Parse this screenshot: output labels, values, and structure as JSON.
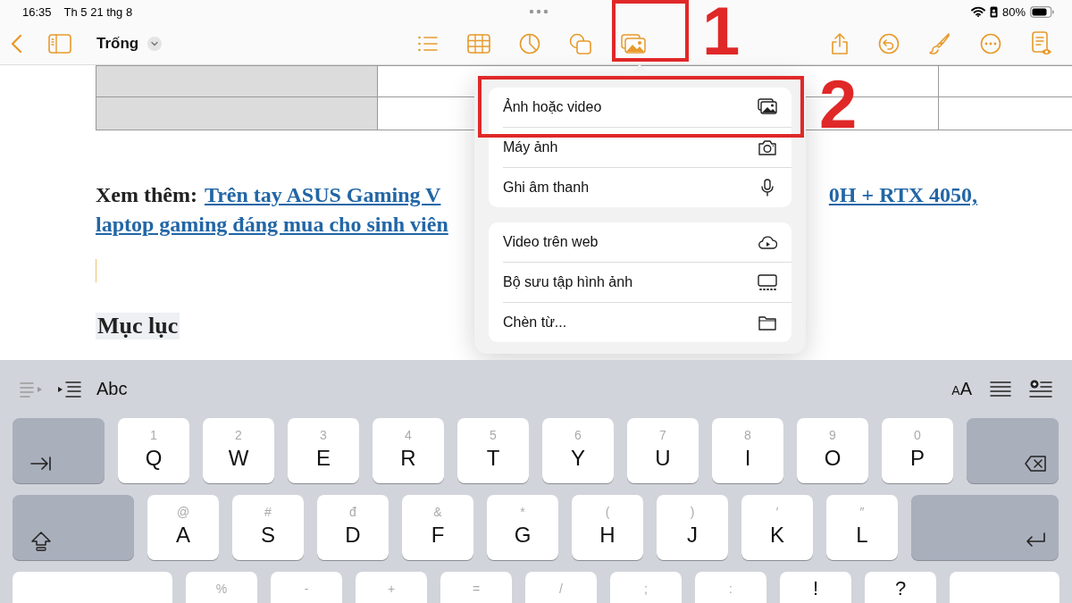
{
  "status_bar": {
    "time": "16:35",
    "date": "Th 5 21 thg 8",
    "battery": "80%"
  },
  "toolbar": {
    "title": "Trống"
  },
  "document": {
    "see_also_label": "Xem thêm:",
    "link_line1_start": "Trên tay ASUS Gaming V",
    "link_line1_end": "0H + RTX 4050,",
    "link_line2": "laptop gaming đáng mua cho sinh viên",
    "heading": "Mục lục"
  },
  "insert_menu": {
    "groups": [
      [
        {
          "label": "Ảnh hoặc video",
          "kind": "photos"
        },
        {
          "label": "Máy ảnh",
          "kind": "camera"
        },
        {
          "label": "Ghi âm thanh",
          "kind": "mic"
        }
      ],
      [
        {
          "label": "Video trên web",
          "kind": "webvideo"
        },
        {
          "label": "Bộ sưu tập hình ảnh",
          "kind": "gallery"
        },
        {
          "label": "Chèn từ...",
          "kind": "folder"
        }
      ]
    ]
  },
  "annotations": [
    {
      "label": "1"
    },
    {
      "label": "2"
    }
  ],
  "keyboard": {
    "shortcut_label": "Abc",
    "text_size_label": "AA",
    "rows": [
      [
        {
          "kind": "tab"
        },
        {
          "kind": "key",
          "hint": "1",
          "label": "Q"
        },
        {
          "kind": "key",
          "hint": "2",
          "label": "W"
        },
        {
          "kind": "key",
          "hint": "3",
          "label": "E"
        },
        {
          "kind": "key",
          "hint": "4",
          "label": "R"
        },
        {
          "kind": "key",
          "hint": "5",
          "label": "T"
        },
        {
          "kind": "key",
          "hint": "6",
          "label": "Y"
        },
        {
          "kind": "key",
          "hint": "7",
          "label": "U"
        },
        {
          "kind": "key",
          "hint": "8",
          "label": "I"
        },
        {
          "kind": "key",
          "hint": "9",
          "label": "O"
        },
        {
          "kind": "key",
          "hint": "0",
          "label": "P"
        },
        {
          "kind": "delete"
        }
      ],
      [
        {
          "kind": "shift"
        },
        {
          "kind": "key",
          "hint": "@",
          "label": "A"
        },
        {
          "kind": "key",
          "hint": "#",
          "label": "S"
        },
        {
          "kind": "key",
          "hint": "đ",
          "label": "D"
        },
        {
          "kind": "key",
          "hint": "&",
          "label": "F"
        },
        {
          "kind": "key",
          "hint": "*",
          "label": "G"
        },
        {
          "kind": "key",
          "hint": "(",
          "label": "H"
        },
        {
          "kind": "key",
          "hint": ")",
          "label": "J"
        },
        {
          "kind": "key",
          "hint": "′",
          "label": "K"
        },
        {
          "kind": "key",
          "hint": "″",
          "label": "L"
        },
        {
          "kind": "return"
        }
      ],
      [
        {
          "kind": "blank-left"
        },
        {
          "kind": "key",
          "hint": "%"
        },
        {
          "kind": "key",
          "hint": "-"
        },
        {
          "kind": "key",
          "hint": "+"
        },
        {
          "kind": "key",
          "hint": "="
        },
        {
          "kind": "key",
          "hint": "/"
        },
        {
          "kind": "key",
          "hint": ";"
        },
        {
          "kind": "key",
          "hint": ":"
        },
        {
          "kind": "key",
          "label": "!"
        },
        {
          "kind": "key",
          "label": "?"
        },
        {
          "kind": "blank-right"
        }
      ]
    ]
  }
}
